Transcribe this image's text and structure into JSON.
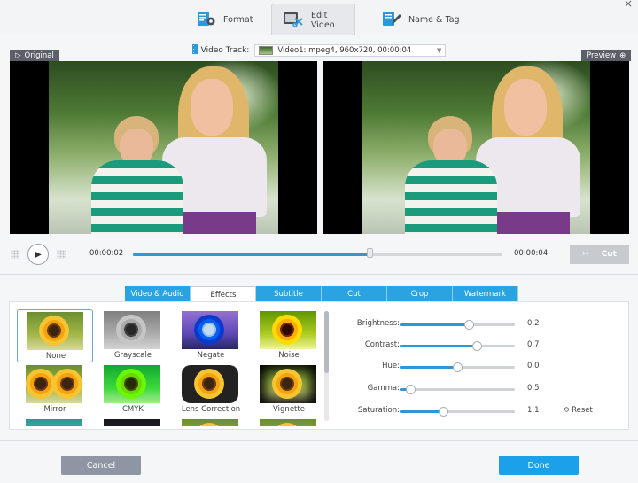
{
  "tabs": {
    "format": "Format",
    "edit_video": "Edit Video",
    "name_tag": "Name & Tag",
    "active": "edit_video"
  },
  "close_glyph": "×",
  "video_track": {
    "label": "Video Track:",
    "value": "Video1: mpeg4, 960x720, 00:00:04"
  },
  "panes": {
    "original_label": "Original",
    "preview_label": "Preview"
  },
  "playback": {
    "current_time": "00:00:02",
    "total_time": "00:00:04",
    "progress": 0.64,
    "cut_label": "Cut"
  },
  "edit_tabs": [
    "Video & Audio",
    "Effects",
    "Subtitle",
    "Cut",
    "Crop",
    "Watermark"
  ],
  "active_edit_tab": "Effects",
  "effects": [
    {
      "label": "None",
      "selected": true
    },
    {
      "label": "Grayscale",
      "selected": false
    },
    {
      "label": "Negate",
      "selected": false
    },
    {
      "label": "Noise",
      "selected": false
    },
    {
      "label": "Mirror",
      "selected": false
    },
    {
      "label": "CMYK",
      "selected": false
    },
    {
      "label": "Lens Correction",
      "selected": false
    },
    {
      "label": "Vignette",
      "selected": false
    }
  ],
  "adjustments": [
    {
      "label": "Brightness:",
      "value": "0.2",
      "fraction": 0.6
    },
    {
      "label": "Contrast:",
      "value": "0.7",
      "fraction": 0.67
    },
    {
      "label": "Hue:",
      "value": "0.0",
      "fraction": 0.5
    },
    {
      "label": "Gamma:",
      "value": "0.5",
      "fraction": 0.09
    },
    {
      "label": "Saturation:",
      "value": "1.1",
      "fraction": 0.38
    }
  ],
  "reset_label": "Reset",
  "footer": {
    "cancel": "Cancel",
    "done": "Done"
  },
  "colors": {
    "accent": "#2aa3e3",
    "done": "#1da0ea",
    "cancel": "#8e96a3"
  }
}
